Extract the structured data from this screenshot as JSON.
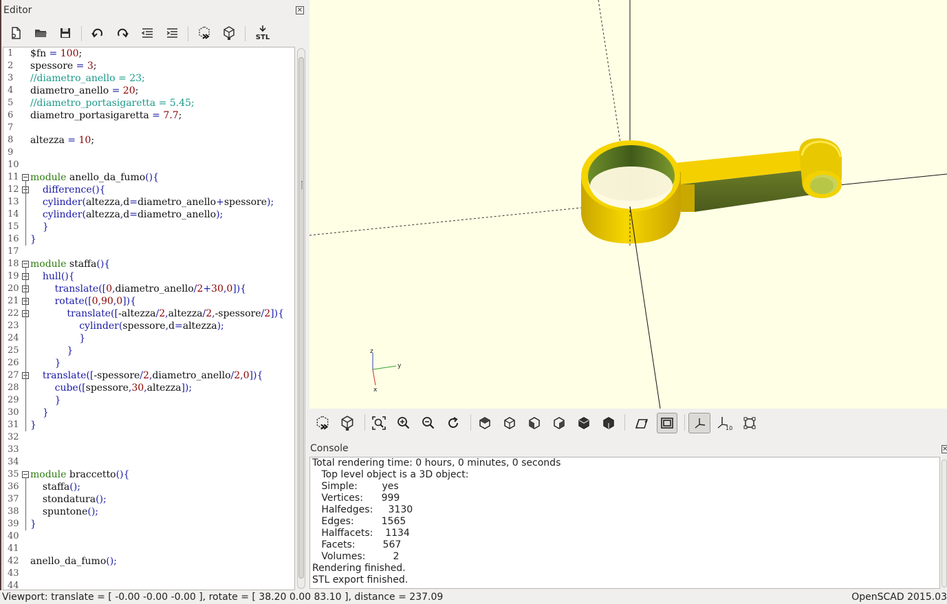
{
  "editor": {
    "title": "Editor",
    "close_glyph": "×",
    "toolbar_icons": [
      "new-file-icon",
      "open-folder-icon",
      "save-icon",
      "undo-icon",
      "redo-icon",
      "unindent-icon",
      "indent-icon",
      "preview-icon",
      "render-icon",
      "export-stl-icon"
    ],
    "stl_label": "STL",
    "code_lines": [
      [
        {
          "t": "$fn",
          "c": "p"
        },
        {
          "t": " = ",
          "c": "op"
        },
        {
          "t": "100",
          "c": "n"
        },
        {
          "t": ";",
          "c": "p"
        }
      ],
      [
        {
          "t": "spessore",
          "c": "p"
        },
        {
          "t": " = ",
          "c": "op"
        },
        {
          "t": "3",
          "c": "n"
        },
        {
          "t": ";",
          "c": "p"
        }
      ],
      [
        {
          "t": "//diametro_anello = 23;",
          "c": "cm"
        }
      ],
      [
        {
          "t": "diametro_anello",
          "c": "p"
        },
        {
          "t": " = ",
          "c": "op"
        },
        {
          "t": "20",
          "c": "n"
        },
        {
          "t": ";",
          "c": "p"
        }
      ],
      [
        {
          "t": "//diametro_portasigaretta = 5.45;",
          "c": "cm"
        }
      ],
      [
        {
          "t": "diametro_portasigaretta",
          "c": "p"
        },
        {
          "t": " = ",
          "c": "op"
        },
        {
          "t": "7.7",
          "c": "n"
        },
        {
          "t": ";",
          "c": "p"
        }
      ],
      [],
      [
        {
          "t": "altezza",
          "c": "p"
        },
        {
          "t": " = ",
          "c": "op"
        },
        {
          "t": "10",
          "c": "n"
        },
        {
          "t": ";",
          "c": "p"
        }
      ],
      [],
      [],
      [
        {
          "t": "module",
          "c": "kw"
        },
        {
          "t": " anello_da_fumo",
          "c": "p"
        },
        {
          "t": "(){",
          "c": "b"
        }
      ],
      [
        {
          "t": "    ",
          "c": "p"
        },
        {
          "t": "difference",
          "c": "fn"
        },
        {
          "t": "(){",
          "c": "b"
        }
      ],
      [
        {
          "t": "    ",
          "c": "p"
        },
        {
          "t": "cylinder",
          "c": "fn"
        },
        {
          "t": "(",
          "c": "b"
        },
        {
          "t": "altezza",
          "c": "p"
        },
        {
          "t": ",",
          "c": "b"
        },
        {
          "t": "d",
          "c": "p"
        },
        {
          "t": "=",
          "c": "op"
        },
        {
          "t": "diametro_anello",
          "c": "p"
        },
        {
          "t": "+",
          "c": "op"
        },
        {
          "t": "spessore",
          "c": "p"
        },
        {
          "t": ");",
          "c": "b"
        }
      ],
      [
        {
          "t": "    ",
          "c": "p"
        },
        {
          "t": "cylinder",
          "c": "fn"
        },
        {
          "t": "(",
          "c": "b"
        },
        {
          "t": "altezza",
          "c": "p"
        },
        {
          "t": ",",
          "c": "b"
        },
        {
          "t": "d",
          "c": "p"
        },
        {
          "t": "=",
          "c": "op"
        },
        {
          "t": "diametro_anello",
          "c": "p"
        },
        {
          "t": ");",
          "c": "b"
        }
      ],
      [
        {
          "t": "    ",
          "c": "p"
        },
        {
          "t": "}",
          "c": "b"
        }
      ],
      [
        {
          "t": "}",
          "c": "b"
        }
      ],
      [],
      [
        {
          "t": "module",
          "c": "kw"
        },
        {
          "t": " staffa",
          "c": "p"
        },
        {
          "t": "(){",
          "c": "b"
        }
      ],
      [
        {
          "t": "    ",
          "c": "p"
        },
        {
          "t": "hull",
          "c": "fn"
        },
        {
          "t": "(){",
          "c": "b"
        }
      ],
      [
        {
          "t": "        ",
          "c": "p"
        },
        {
          "t": "translate",
          "c": "fn"
        },
        {
          "t": "([",
          "c": "b"
        },
        {
          "t": "0",
          "c": "n"
        },
        {
          "t": ",",
          "c": "b"
        },
        {
          "t": "diametro_anello",
          "c": "p"
        },
        {
          "t": "/",
          "c": "op"
        },
        {
          "t": "2",
          "c": "n"
        },
        {
          "t": "+",
          "c": "op"
        },
        {
          "t": "30",
          "c": "n"
        },
        {
          "t": ",",
          "c": "b"
        },
        {
          "t": "0",
          "c": "n"
        },
        {
          "t": "]){",
          "c": "b"
        }
      ],
      [
        {
          "t": "        ",
          "c": "p"
        },
        {
          "t": "rotate",
          "c": "fn"
        },
        {
          "t": "([",
          "c": "b"
        },
        {
          "t": "0",
          "c": "n"
        },
        {
          "t": ",",
          "c": "b"
        },
        {
          "t": "90",
          "c": "n"
        },
        {
          "t": ",",
          "c": "b"
        },
        {
          "t": "0",
          "c": "n"
        },
        {
          "t": "]){",
          "c": "b"
        }
      ],
      [
        {
          "t": "            ",
          "c": "p"
        },
        {
          "t": "translate",
          "c": "fn"
        },
        {
          "t": "([",
          "c": "b"
        },
        {
          "t": "-altezza",
          "c": "p"
        },
        {
          "t": "/",
          "c": "op"
        },
        {
          "t": "2",
          "c": "n"
        },
        {
          "t": ",",
          "c": "b"
        },
        {
          "t": "altezza",
          "c": "p"
        },
        {
          "t": "/",
          "c": "op"
        },
        {
          "t": "2",
          "c": "n"
        },
        {
          "t": ",",
          "c": "b"
        },
        {
          "t": "-spessore",
          "c": "p"
        },
        {
          "t": "/",
          "c": "op"
        },
        {
          "t": "2",
          "c": "n"
        },
        {
          "t": "]){",
          "c": "b"
        }
      ],
      [
        {
          "t": "                ",
          "c": "p"
        },
        {
          "t": "cylinder",
          "c": "fn"
        },
        {
          "t": "(",
          "c": "b"
        },
        {
          "t": "spessore",
          "c": "p"
        },
        {
          "t": ",",
          "c": "b"
        },
        {
          "t": "d",
          "c": "p"
        },
        {
          "t": "=",
          "c": "op"
        },
        {
          "t": "altezza",
          "c": "p"
        },
        {
          "t": ");",
          "c": "b"
        }
      ],
      [
        {
          "t": "                ",
          "c": "p"
        },
        {
          "t": "}",
          "c": "b"
        }
      ],
      [
        {
          "t": "            ",
          "c": "p"
        },
        {
          "t": "}",
          "c": "b"
        }
      ],
      [
        {
          "t": "        ",
          "c": "p"
        },
        {
          "t": "}",
          "c": "b"
        }
      ],
      [
        {
          "t": "    ",
          "c": "p"
        },
        {
          "t": "translate",
          "c": "fn"
        },
        {
          "t": "([",
          "c": "b"
        },
        {
          "t": "-spessore",
          "c": "p"
        },
        {
          "t": "/",
          "c": "op"
        },
        {
          "t": "2",
          "c": "n"
        },
        {
          "t": ",",
          "c": "b"
        },
        {
          "t": "diametro_anello",
          "c": "p"
        },
        {
          "t": "/",
          "c": "op"
        },
        {
          "t": "2",
          "c": "n"
        },
        {
          "t": ",",
          "c": "b"
        },
        {
          "t": "0",
          "c": "n"
        },
        {
          "t": "]){",
          "c": "b"
        }
      ],
      [
        {
          "t": "        ",
          "c": "p"
        },
        {
          "t": "cube",
          "c": "fn"
        },
        {
          "t": "([",
          "c": "b"
        },
        {
          "t": "spessore",
          "c": "p"
        },
        {
          "t": ",",
          "c": "b"
        },
        {
          "t": "30",
          "c": "n"
        },
        {
          "t": ",",
          "c": "b"
        },
        {
          "t": "altezza",
          "c": "p"
        },
        {
          "t": "]);",
          "c": "b"
        }
      ],
      [
        {
          "t": "        ",
          "c": "p"
        },
        {
          "t": "}",
          "c": "b"
        }
      ],
      [
        {
          "t": "    ",
          "c": "p"
        },
        {
          "t": "}",
          "c": "b"
        }
      ],
      [
        {
          "t": "}",
          "c": "b"
        }
      ],
      [],
      [],
      [],
      [
        {
          "t": "module",
          "c": "kw"
        },
        {
          "t": " braccetto",
          "c": "p"
        },
        {
          "t": "(){",
          "c": "b"
        }
      ],
      [
        {
          "t": "    ",
          "c": "p"
        },
        {
          "t": "staffa",
          "c": "p"
        },
        {
          "t": "();",
          "c": "b"
        }
      ],
      [
        {
          "t": "    ",
          "c": "p"
        },
        {
          "t": "stondatura",
          "c": "p"
        },
        {
          "t": "();",
          "c": "b"
        }
      ],
      [
        {
          "t": "    ",
          "c": "p"
        },
        {
          "t": "spuntone",
          "c": "p"
        },
        {
          "t": "();",
          "c": "b"
        }
      ],
      [
        {
          "t": "}",
          "c": "b"
        }
      ],
      [],
      [],
      [
        {
          "t": "anello_da_fumo",
          "c": "p"
        },
        {
          "t": "();",
          "c": "b"
        }
      ],
      [],
      []
    ],
    "fold_markers": [
      11,
      12,
      18,
      19,
      20,
      21,
      22,
      27,
      35
    ]
  },
  "syntax_colors": {
    "p": "#111111",
    "op": "#1a1aa6",
    "n": "#8b0000",
    "cm": "#1a9a8a",
    "kw": "#2e7d10",
    "fn": "#1a1aa6",
    "b": "#1a1aa6"
  },
  "viewport": {
    "background": "#ffffe5",
    "model_color": "#f5d000",
    "axis_labels": {
      "z": "z",
      "y": "y",
      "x": "x"
    }
  },
  "view_toolbar": {
    "icons": [
      "preview-icon",
      "render-icon",
      "view-all-icon",
      "zoom-in-icon",
      "zoom-out-icon",
      "reset-view-icon",
      "view-top-icon",
      "view-bottom-icon",
      "view-left-icon",
      "view-right-icon",
      "view-front-icon",
      "view-back-icon",
      "perspective-icon",
      "orthogonal-icon",
      "show-axes-icon",
      "show-scale-markers-icon",
      "show-edges-icon"
    ],
    "active": [
      "orthogonal-icon",
      "show-axes-icon"
    ],
    "scale_marker_label": "10"
  },
  "console": {
    "title": "Console",
    "close_glyph": "×",
    "lines": [
      "Total rendering time: 0 hours, 0 minutes, 0 seconds",
      "   Top level object is a 3D object:",
      "   Simple:        yes",
      "   Vertices:      999",
      "   Halfedges:     3130",
      "   Edges:         1565",
      "   Halffacets:    1134",
      "   Facets:         567",
      "   Volumes:         2",
      "Rendering finished.",
      "STL export finished."
    ]
  },
  "status": {
    "viewport_info": "Viewport: translate = [ -0.00 -0.00 -0.00 ], rotate = [ 38.20 0.00 83.10 ], distance = 237.09",
    "app_version": "OpenSCAD 2015.03"
  }
}
